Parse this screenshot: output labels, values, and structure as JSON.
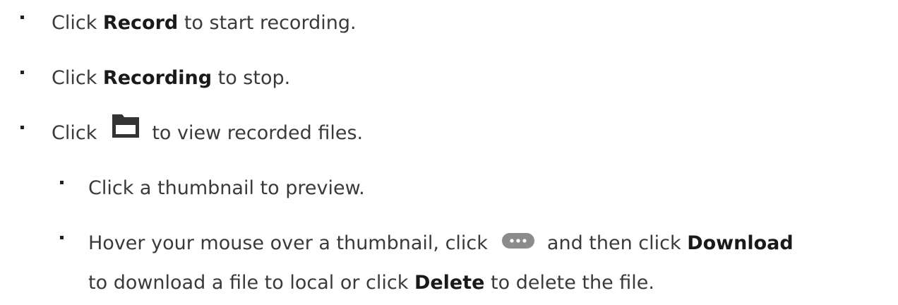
{
  "list": {
    "item1": {
      "pre": "Click ",
      "bold": "Record",
      "post": " to start recording."
    },
    "item2": {
      "pre": "Click ",
      "bold": "Recording",
      "post": " to stop."
    },
    "item3": {
      "pre": "Click",
      "icon": "folder-icon",
      "post": "to view recorded files."
    },
    "sub1": {
      "text": "Click a thumbnail to preview."
    },
    "sub2": {
      "pre": "Hover your mouse over a thumbnail, click",
      "icon": "more-options-icon",
      "mid": "and then click ",
      "bold1": "Download",
      "line2_pre": "to download a file to local or click ",
      "bold2": "Delete",
      "line2_post": " to delete the file."
    }
  },
  "colors": {
    "text": "#3a3a3a",
    "bold_text": "#1a1a1a",
    "icon": "#333333",
    "more_button": "#8c8c8c"
  }
}
